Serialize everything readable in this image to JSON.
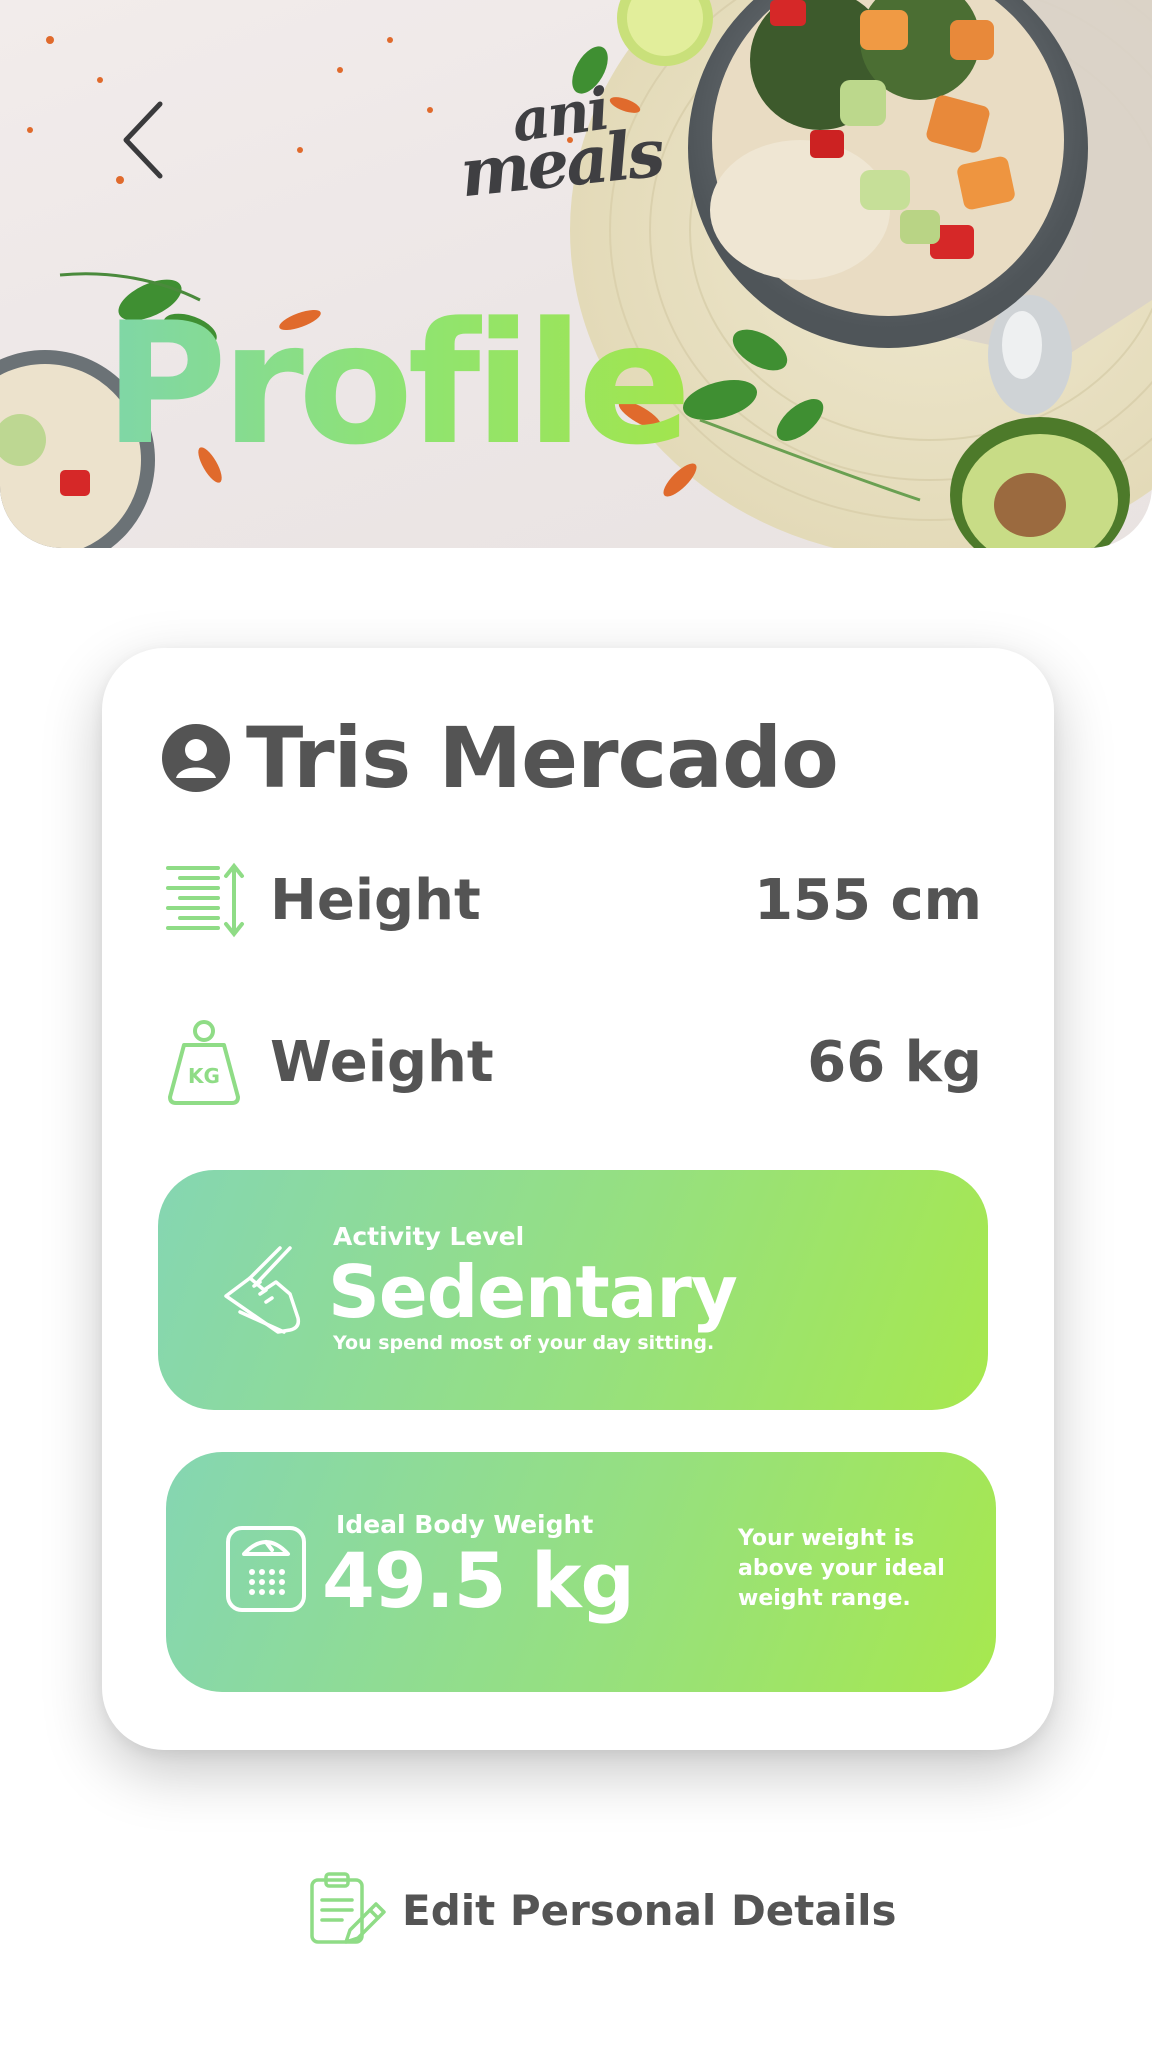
{
  "header": {
    "logo_line1": "ani",
    "logo_line2": "meals",
    "title": "Profile"
  },
  "profile": {
    "name": "Tris Mercado",
    "height": {
      "label": "Height",
      "value": "155 cm",
      "icon": "height-icon"
    },
    "weight": {
      "label": "Weight",
      "value": "66 kg",
      "icon": "weight-kg-icon",
      "icon_text": "KG"
    }
  },
  "activity": {
    "caption": "Activity Level",
    "level": "Sedentary",
    "description": "You spend most of your day sitting.",
    "icon": "shoe-icon"
  },
  "ideal_weight": {
    "caption": "Ideal Body Weight",
    "value": "49.5 kg",
    "note": "Your weight is above your ideal weight range.",
    "icon": "scale-icon"
  },
  "edit": {
    "label": "Edit Personal Details",
    "icon": "clipboard-edit-icon"
  },
  "colors": {
    "text": "#545454",
    "green_start": "#85d6b2",
    "green_end": "#a7e84e"
  }
}
